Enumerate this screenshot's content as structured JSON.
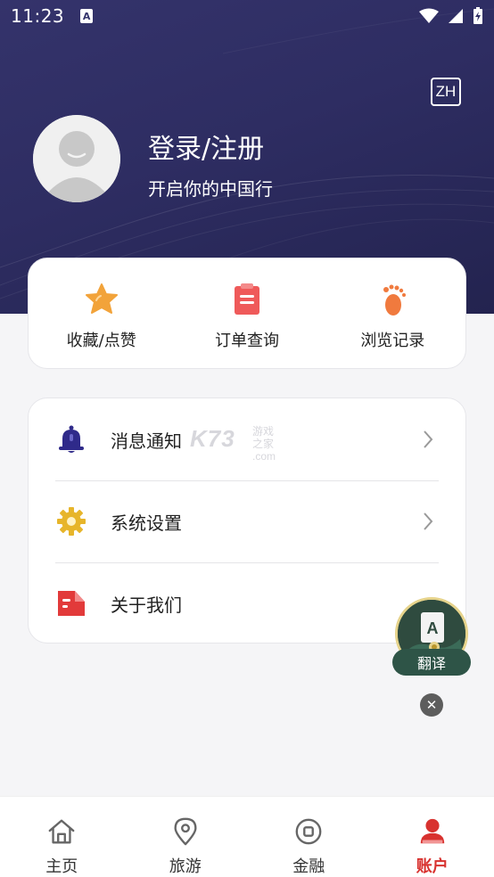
{
  "status_bar": {
    "time": "11:23",
    "notif_letter": "A"
  },
  "header": {
    "lang_label": "ZH",
    "login_title": "登录/注册",
    "login_subtitle": "开启你的中国行"
  },
  "quick_actions": [
    {
      "label": "收藏/点赞",
      "icon": "star-icon",
      "color": "#f2a33a"
    },
    {
      "label": "订单查询",
      "icon": "order-clipboard-icon",
      "color": "#ef5a5a"
    },
    {
      "label": "浏览记录",
      "icon": "footprint-icon",
      "color": "#f07a3e"
    }
  ],
  "menu": [
    {
      "label": "消息通知",
      "icon": "bell-icon",
      "color": "#2f2a8a",
      "has_arrow": true
    },
    {
      "label": "系统设置",
      "icon": "gear-icon",
      "color": "#e7b52a",
      "has_arrow": true
    },
    {
      "label": "关于我们",
      "icon": "about-card-icon",
      "color": "#e23a3a",
      "has_arrow": false
    }
  ],
  "watermark": {
    "main": "K73",
    "line1": "游戏之家",
    "line2": ".com"
  },
  "translate": {
    "label": "翻译",
    "letter": "A"
  },
  "tabbar": [
    {
      "label": "主页",
      "icon": "home-icon",
      "active": false
    },
    {
      "label": "旅游",
      "icon": "location-pin-icon",
      "active": false
    },
    {
      "label": "金融",
      "icon": "coin-icon",
      "active": false
    },
    {
      "label": "账户",
      "icon": "account-icon",
      "active": true
    }
  ],
  "colors": {
    "hero": "#2e2d62",
    "active_tab": "#d8322f"
  }
}
